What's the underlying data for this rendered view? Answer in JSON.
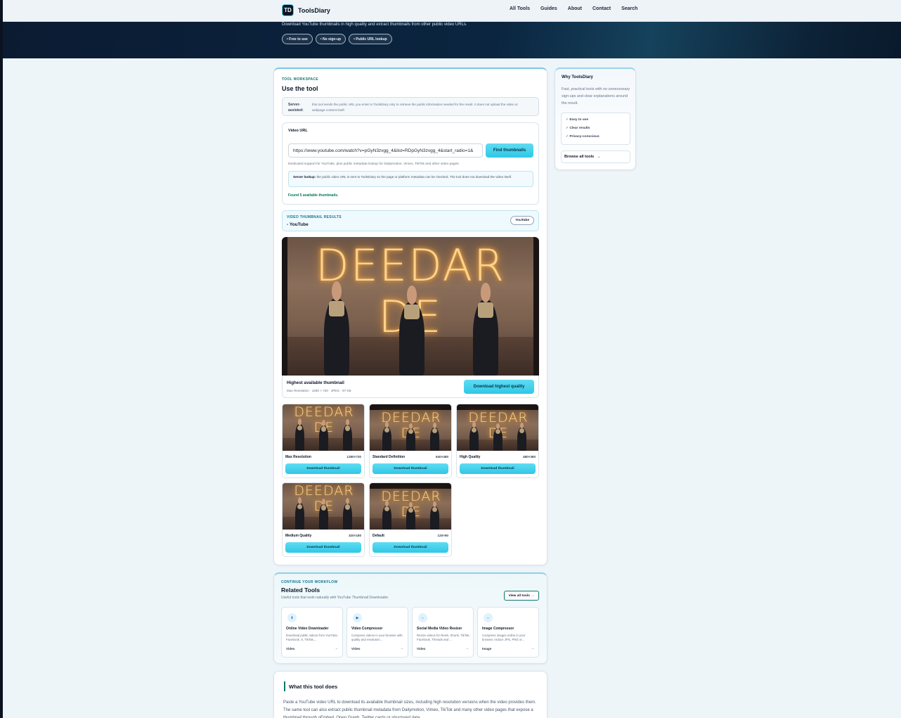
{
  "header": {
    "logo_mark": "TD",
    "brand": "ToolsDiary",
    "nav": [
      "All Tools",
      "Guides",
      "About",
      "Contact",
      "Search"
    ]
  },
  "hero": {
    "subtitle": "Download YouTube thumbnails in high quality and extract thumbnails from other public video URLs.",
    "pills": [
      "Free to use",
      "No sign-up",
      "Public URL lookup"
    ]
  },
  "workspace": {
    "eyebrow": "TOOL WORKSPACE",
    "title": "Use the tool",
    "notice_label": "Server-assisted:",
    "notice_text": "this tool sends the public URL you enter to ToolsDiary only to retrieve the public information needed for the result. It does not upload the video or webpage content itself.",
    "url_label": "Video URL",
    "url_value": "https://www.youtube.com/watch?v=pGyN3zvgg_4&list=RDpGyN3zvgg_4&start_radio=1&",
    "find_button": "Find thumbnails",
    "help_text": "Dedicated support for YouTube, plus public metadata lookup for Dailymotion, Vimeo, TikTok and other video pages.",
    "lookup_label": "Server lookup:",
    "lookup_text": "the public video URL is sent to ToolsDiary so the page or platform metadata can be checked. The tool does not download the video itself.",
    "found_text": "Found 5 available thumbnails."
  },
  "results": {
    "eyebrow": "VIDEO THUMBNAIL RESULTS",
    "subtitle": "- YouTube",
    "badge": "YouTube",
    "thumb_title": "DEEDAR DE",
    "highest_title": "Highest available thumbnail",
    "highest_meta": "Max Resolution · 1280 × 720 · JPEG · 97 KB",
    "highest_button": "Download highest quality",
    "tiles": [
      {
        "name": "Max Resolution",
        "size": "1280×720",
        "button": "Download thumbnail"
      },
      {
        "name": "Standard Definition",
        "size": "640×480",
        "button": "Download thumbnail"
      },
      {
        "name": "High Quality",
        "size": "480×360",
        "button": "Download thumbnail"
      },
      {
        "name": "Medium Quality",
        "size": "320×180",
        "button": "Download thumbnail"
      },
      {
        "name": "Default",
        "size": "120×90",
        "button": "Download thumbnail"
      }
    ]
  },
  "sidebar": {
    "title": "Why ToolsDiary",
    "description": "Fast, practical tools with no unnecessary sign-ups and clear explanations around the result.",
    "features": [
      "✓ Easy to use",
      "✓ Clear results",
      "✓ Privacy-conscious"
    ],
    "browse": "Browse all tools",
    "browse_arrow": "→"
  },
  "related": {
    "eyebrow": "CONTINUE YOUR WORKFLOW",
    "title": "Related Tools",
    "subtitle": "Useful tools that work naturally with YouTube Thumbnail Downloader.",
    "view_all": "View all tools →",
    "tools": [
      {
        "icon": "⬇",
        "name": "Online Video Downloader",
        "desc": "Download public videos from YouTube, Facebook, X, TikTok,...",
        "category": "Video",
        "arrow": "→"
      },
      {
        "icon": "▶",
        "name": "Video Compressor",
        "desc": "Compress videos in your browser with quality and resolution...",
        "category": "Video",
        "arrow": "→"
      },
      {
        "icon": "⇔",
        "name": "Social Media Video Resizer",
        "desc": "Resize videos for Reels, Shorts, TikTok, Facebook, Threads and ...",
        "category": "Video",
        "arrow": "→"
      },
      {
        "icon": "⇔",
        "name": "Image Compressor",
        "desc": "Compress images online in your browser, reduce JPG, PNG or...",
        "category": "Image",
        "arrow": "→"
      }
    ]
  },
  "what": {
    "title": "What this tool does",
    "body": "Paste a YouTube video URL to download its available thumbnail sizes, including high resolution versions when the video provides them. The same tool can also extract public thumbnail metadata from Dailymotion, Vimeo, TikTok and many other video pages that expose a thumbnail through oEmbed, Open Graph, Twitter cards or structured data."
  }
}
